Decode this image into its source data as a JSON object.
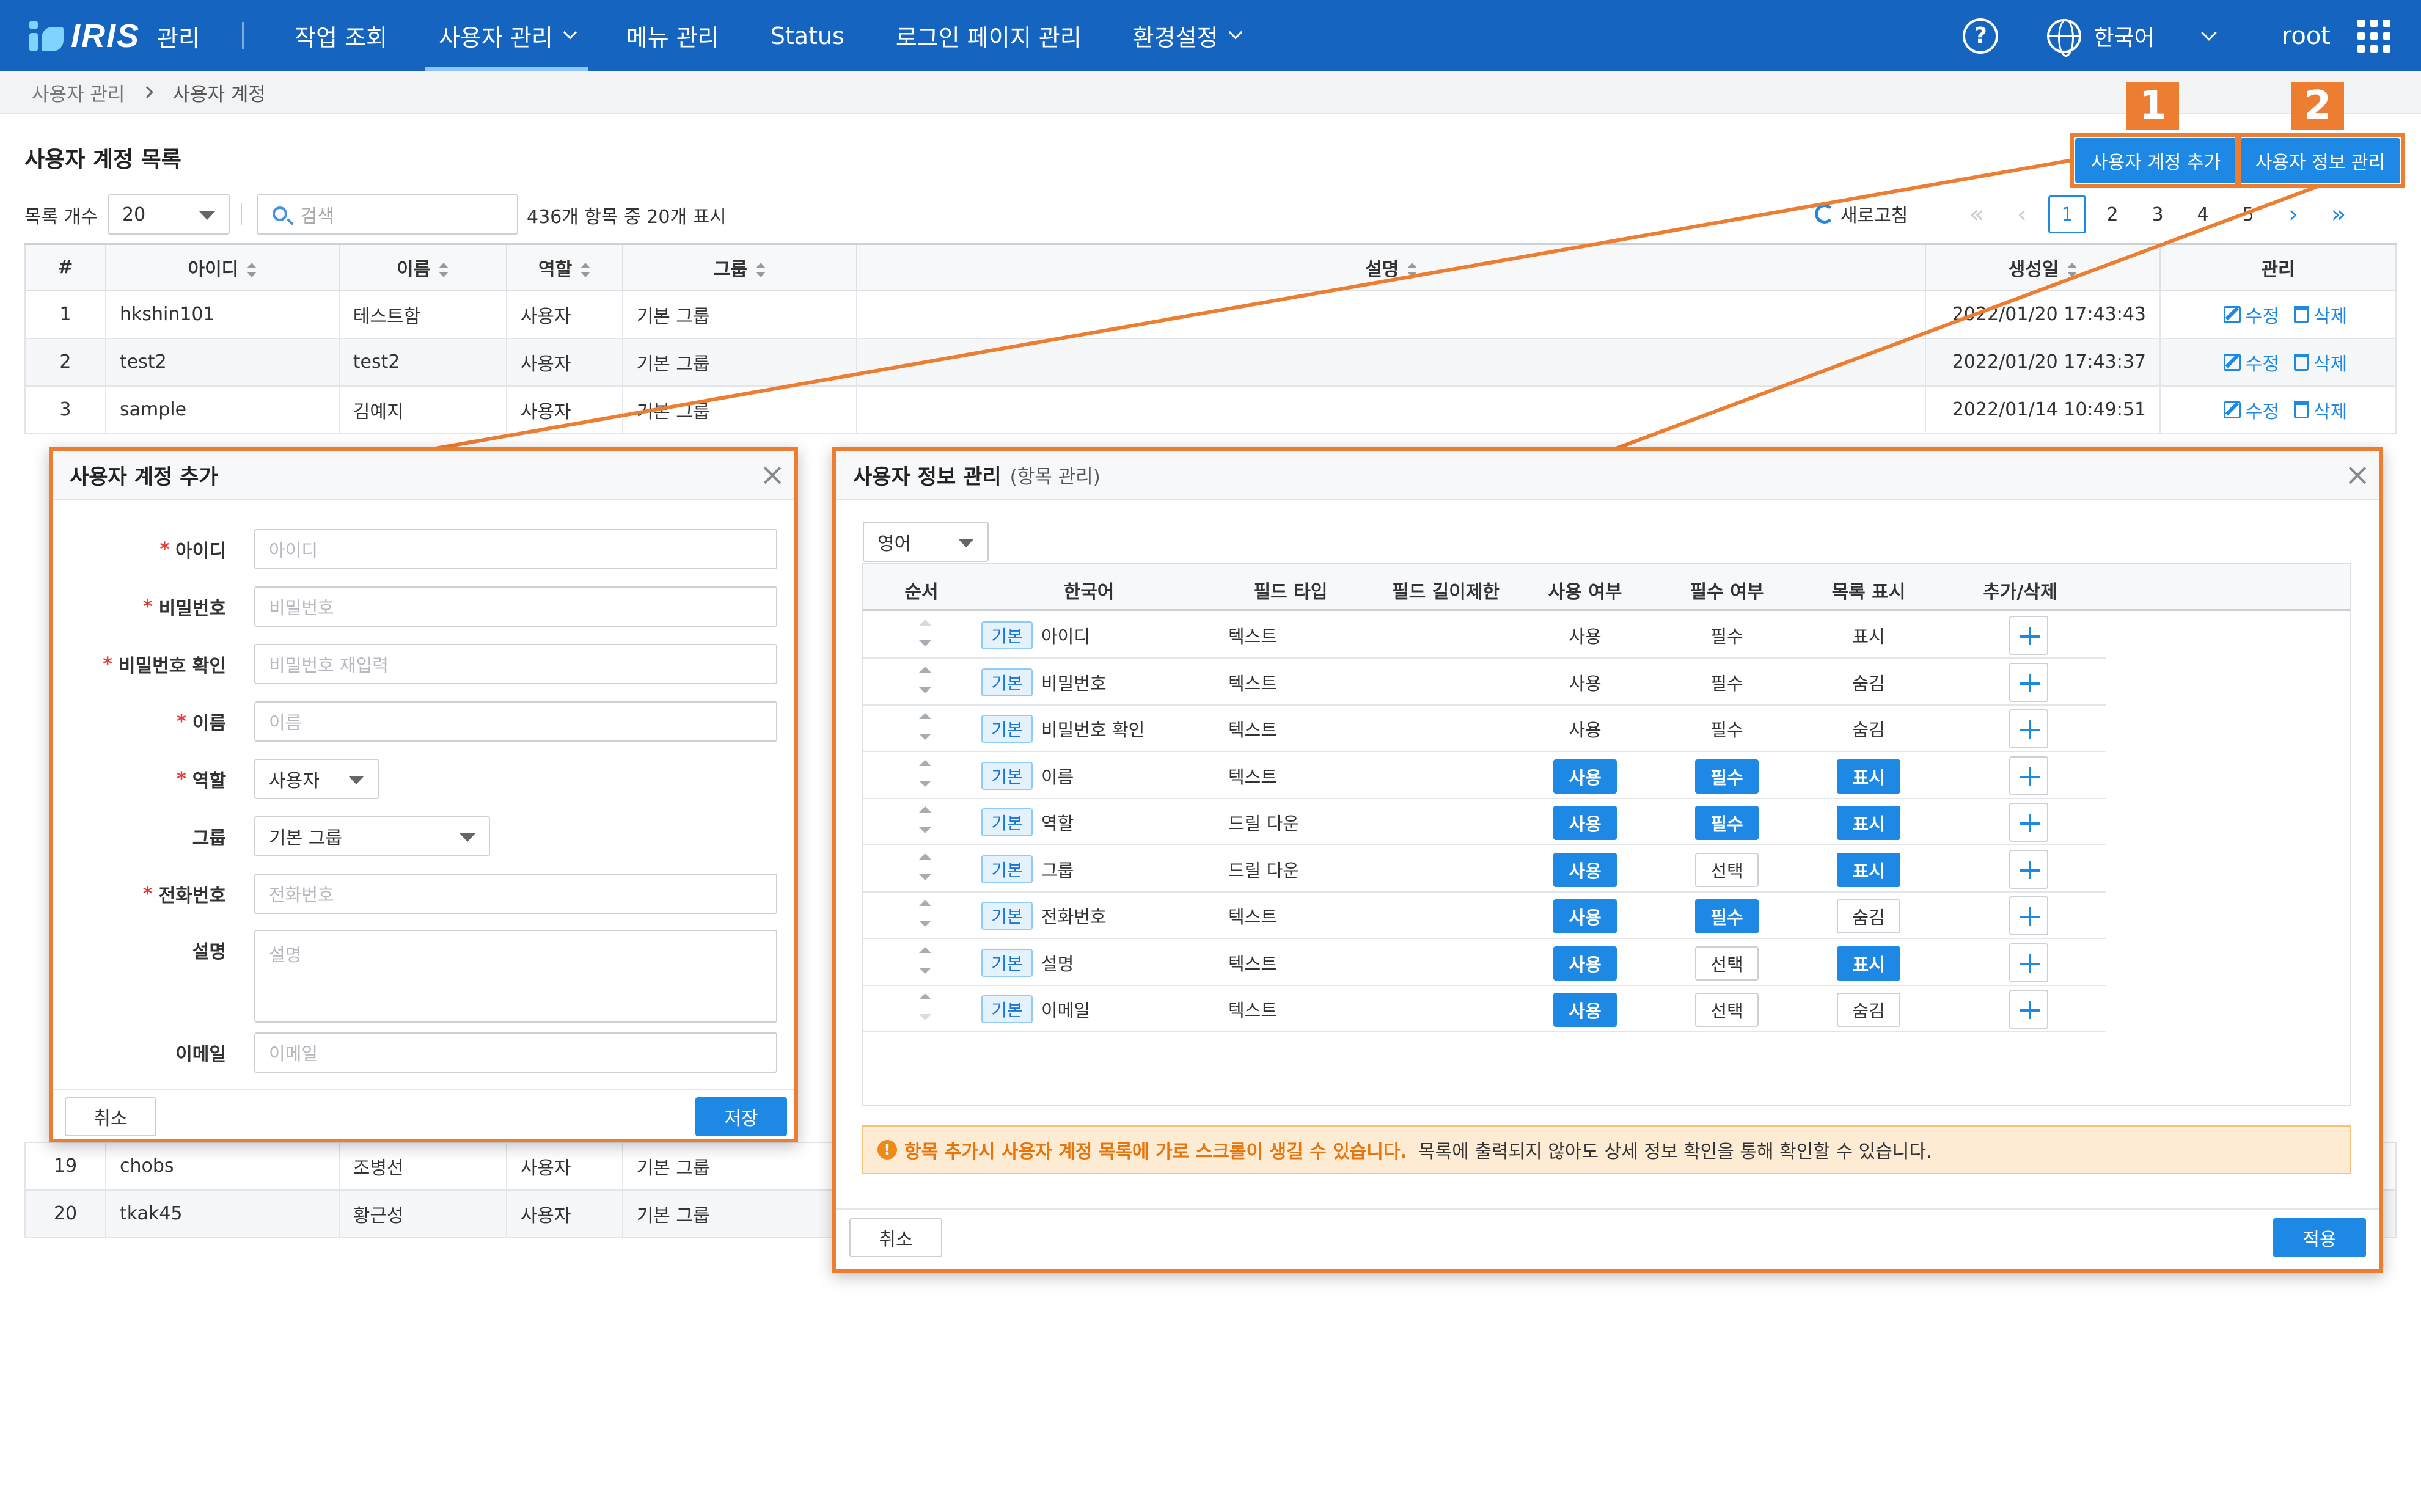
{
  "nav": {
    "logo_text": "IRIS",
    "logo_suffix": "관리",
    "menu": [
      {
        "label": "작업 조회",
        "dropdown": false,
        "active": false
      },
      {
        "label": "사용자 관리",
        "dropdown": true,
        "active": true
      },
      {
        "label": "메뉴 관리",
        "dropdown": false,
        "active": false
      },
      {
        "label": "Status",
        "dropdown": false,
        "active": false
      },
      {
        "label": "로그인 페이지 관리",
        "dropdown": false,
        "active": false
      },
      {
        "label": "환경설정",
        "dropdown": true,
        "active": false
      }
    ],
    "help_glyph": "?",
    "language": "한국어",
    "user": "root"
  },
  "breadcrumb": {
    "parent": "사용자 관리",
    "current": "사용자 계정"
  },
  "page": {
    "title": "사용자 계정 목록",
    "add_button": "사용자 계정 추가",
    "info_button": "사용자 정보 관리",
    "callout_1": "1",
    "callout_2": "2"
  },
  "toolbar": {
    "count_label": "목록 개수",
    "count_value": "20",
    "search_placeholder": "검색",
    "summary": "436개 항목 중 20개 표시",
    "refresh_label": "새로고침",
    "pages": [
      "1",
      "2",
      "3",
      "4",
      "5"
    ],
    "current_page": "1"
  },
  "table": {
    "columns": [
      "#",
      "아이디",
      "이름",
      "역할",
      "그룹",
      "설명",
      "생성일",
      "관리"
    ],
    "edit_label": "수정",
    "delete_label": "삭제",
    "rows_top": [
      {
        "num": "1",
        "id": "hkshin101",
        "name": "테스트함",
        "role": "사용자",
        "group": "기본 그룹",
        "desc": "",
        "created": "2022/01/20 17:43:43"
      },
      {
        "num": "2",
        "id": "test2",
        "name": "test2",
        "role": "사용자",
        "group": "기본 그룹",
        "desc": "",
        "created": "2022/01/20 17:43:37"
      },
      {
        "num": "3",
        "id": "sample",
        "name": "김예지",
        "role": "사용자",
        "group": "기본 그룹",
        "desc": "",
        "created": "2022/01/14 10:49:51"
      }
    ],
    "rows_bottom": [
      {
        "num": "19",
        "id": "chobs",
        "name": "조병선",
        "role": "사용자",
        "group": "기본 그룹"
      },
      {
        "num": "20",
        "id": "tkak45",
        "name": "황근성",
        "role": "사용자",
        "group": "기본 그룹"
      }
    ]
  },
  "add_modal": {
    "title": "사용자 계정 추가",
    "fields": [
      {
        "label": "아이디",
        "required": true,
        "placeholder": "아이디"
      },
      {
        "label": "비밀번호",
        "required": true,
        "placeholder": "비밀번호"
      },
      {
        "label": "비밀번호 확인",
        "required": true,
        "placeholder": "비밀번호 재입력"
      },
      {
        "label": "이름",
        "required": true,
        "placeholder": "이름"
      },
      {
        "label": "역할",
        "required": true,
        "value": "사용자"
      },
      {
        "label": "그룹",
        "required": false,
        "value": "기본 그룹"
      },
      {
        "label": "전화번호",
        "required": true,
        "placeholder": "전화번호"
      },
      {
        "label": "설명",
        "required": false,
        "placeholder": "설명"
      },
      {
        "label": "이메일",
        "required": false,
        "placeholder": "이메일"
      }
    ],
    "required_mark": "*",
    "cancel": "취소",
    "save": "저장"
  },
  "info_modal": {
    "title": "사용자 정보 관리",
    "subtitle": "(항목 관리)",
    "language_select": "영어",
    "columns": [
      "순서",
      "한국어",
      "필드 타입",
      "필드 길이제한",
      "사용 여부",
      "필수 여부",
      "목록 표시",
      "추가/삭제"
    ],
    "tag": "기본",
    "rows": [
      {
        "name": "아이디",
        "type": "텍스트",
        "use": "사용",
        "use_on": false,
        "req": "필수",
        "req_on": false,
        "show": "표시",
        "show_on": false,
        "fixed": true
      },
      {
        "name": "비밀번호",
        "type": "텍스트",
        "use": "사용",
        "use_on": false,
        "req": "필수",
        "req_on": false,
        "show": "숨김",
        "show_on": false,
        "fixed": true
      },
      {
        "name": "비밀번호 확인",
        "type": "텍스트",
        "use": "사용",
        "use_on": false,
        "req": "필수",
        "req_on": false,
        "show": "숨김",
        "show_on": false,
        "fixed": true
      },
      {
        "name": "이름",
        "type": "텍스트",
        "use": "사용",
        "use_on": true,
        "req": "필수",
        "req_on": true,
        "show": "표시",
        "show_on": true,
        "fixed": false
      },
      {
        "name": "역할",
        "type": "드릴 다운",
        "use": "사용",
        "use_on": true,
        "req": "필수",
        "req_on": true,
        "show": "표시",
        "show_on": true,
        "fixed": false
      },
      {
        "name": "그룹",
        "type": "드릴 다운",
        "use": "사용",
        "use_on": true,
        "req": "선택",
        "req_on": false,
        "show": "표시",
        "show_on": true,
        "fixed": false
      },
      {
        "name": "전화번호",
        "type": "텍스트",
        "use": "사용",
        "use_on": true,
        "req": "필수",
        "req_on": true,
        "show": "숨김",
        "show_on": false,
        "fixed": false
      },
      {
        "name": "설명",
        "type": "텍스트",
        "use": "사용",
        "use_on": true,
        "req": "선택",
        "req_on": false,
        "show": "표시",
        "show_on": true,
        "fixed": false
      },
      {
        "name": "이메일",
        "type": "텍스트",
        "use": "사용",
        "use_on": true,
        "req": "선택",
        "req_on": false,
        "show": "숨김",
        "show_on": false,
        "fixed": false
      }
    ],
    "notice_icon": "!",
    "notice_highlight": "항목 추가시 사용자 계정 목록에 가로 스크롤이 생길 수 있습니다.",
    "notice_text": "목록에 출력되지 않아도 상세 정보 확인을 통해 확인할 수 있습니다.",
    "cancel": "취소",
    "apply": "적용"
  },
  "colors": {
    "nav": "#1565c0",
    "accent": "#1e88e5",
    "callout": "#ed7d31",
    "required": "#e53935",
    "notice_bg": "#fdebd3"
  }
}
